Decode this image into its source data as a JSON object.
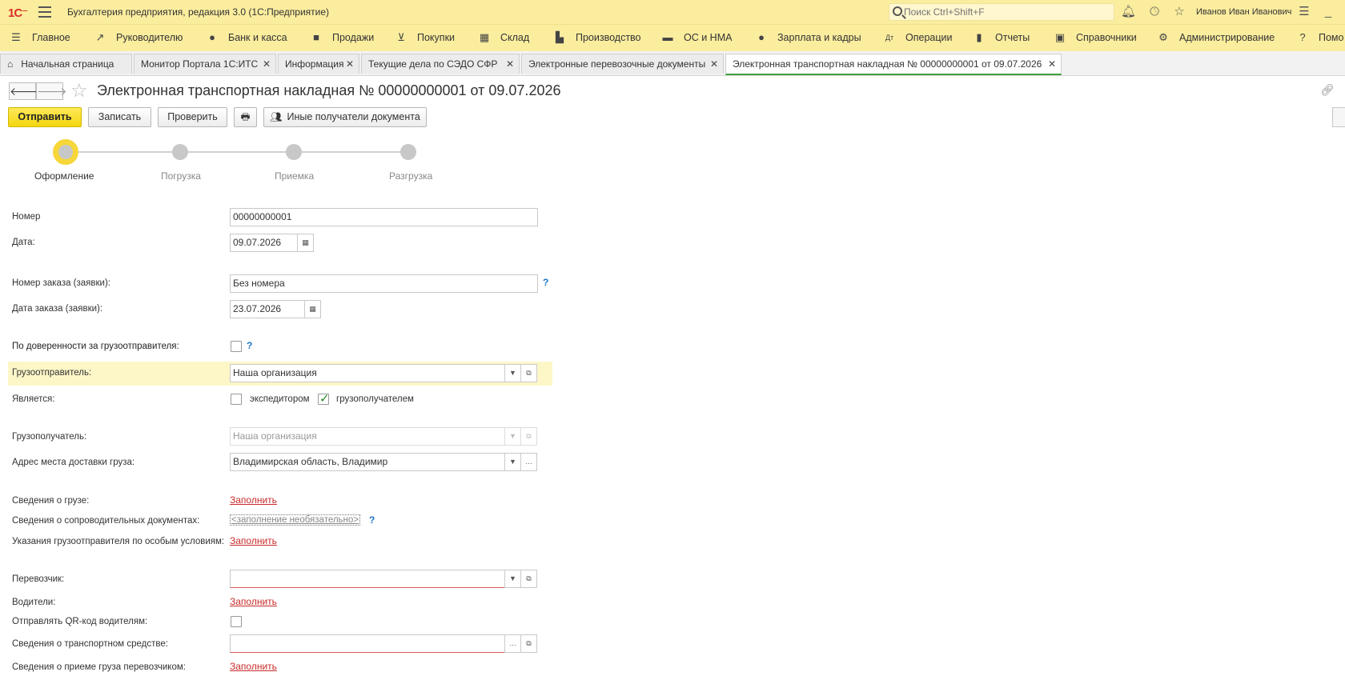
{
  "titlebar": {
    "logo": "1С",
    "app_title": "Бухгалтерия предприятия, редакция 3.0  (1С:Предприятие)",
    "search_placeholder": "Поиск Ctrl+Shift+F",
    "user_name": "Иванов Иван Иванович"
  },
  "sections": [
    {
      "label": "Главное",
      "icon": "menu-icon"
    },
    {
      "label": "Руководителю",
      "icon": "trend-icon"
    },
    {
      "label": "Банк и касса",
      "icon": "coin-icon"
    },
    {
      "label": "Продажи",
      "icon": "bag-icon"
    },
    {
      "label": "Покупки",
      "icon": "cart-icon"
    },
    {
      "label": "Склад",
      "icon": "grid-icon"
    },
    {
      "label": "Производство",
      "icon": "factory-icon"
    },
    {
      "label": "ОС и НМА",
      "icon": "truck-icon"
    },
    {
      "label": "Зарплата и кадры",
      "icon": "person-icon"
    },
    {
      "label": "Операции",
      "icon": "operations-icon"
    },
    {
      "label": "Отчеты",
      "icon": "bars-icon"
    },
    {
      "label": "Справочники",
      "icon": "book-icon"
    },
    {
      "label": "Администрирование",
      "icon": "gear-icon"
    },
    {
      "label": "Помо",
      "icon": "help-icon"
    }
  ],
  "tabs": [
    {
      "label": "Начальная страница"
    },
    {
      "label": "Монитор Портала 1С:ИТС"
    },
    {
      "label": "Информация"
    },
    {
      "label": "Текущие дела по СЭДО СФР"
    },
    {
      "label": "Электронные перевозочные документы"
    },
    {
      "label": "Электронная транспортная накладная № 00000000001 от 09.07.2026"
    }
  ],
  "header": {
    "title": "Электронная транспортная накладная № 00000000001 от 09.07.2026"
  },
  "toolbar": {
    "send": "Отправить",
    "save": "Записать",
    "check": "Проверить",
    "recipients": "Иные получатели документа"
  },
  "steps": [
    {
      "label": "Оформление",
      "active": true
    },
    {
      "label": "Погрузка",
      "active": false
    },
    {
      "label": "Приемка",
      "active": false
    },
    {
      "label": "Разгрузка",
      "active": false
    }
  ],
  "form": {
    "number_label": "Номер",
    "number_value": "00000000001",
    "date_label": "Дата:",
    "date_value": "09.07.2026",
    "order_number_label": "Номер заказа (заявки):",
    "order_number_value": "Без номера",
    "order_date_label": "Дата заказа (заявки):",
    "order_date_value": "23.07.2026",
    "proxy_label": "По доверенности за грузоотправителя:",
    "shipper_label": "Грузоотправитель:",
    "shipper_value": "Наша организация",
    "role_label": "Является:",
    "role_forwarder": "экспедитором",
    "role_consignee": "грузополучателем",
    "consignee_label": "Грузополучатель:",
    "consignee_value": "Наша организация",
    "address_label": "Адрес места доставки груза:",
    "address_value": "Владимирская область, Владимир",
    "cargo_label": "Сведения о грузе:",
    "docs_label": "Сведения о сопроводительных документах:",
    "docs_value": "<заполнение необязательно>",
    "special_label": "Указания грузоотправителя по особым условиям:",
    "carrier_label": "Перевозчик:",
    "carrier_value": "",
    "drivers_label": "Водители:",
    "qr_label": "Отправлять QR-код водителям:",
    "vehicle_label": "Сведения о транспортном средстве:",
    "vehicle_value": "",
    "acceptance_label": "Сведения о приеме груза перевозчиком:",
    "fill_link": "Заполнить",
    "help": "?"
  },
  "colors": {
    "header_bg": "#fbed9e",
    "primary_button": "#f3d610",
    "active_step": "#f7d63a",
    "link_red": "#c92b2b"
  }
}
